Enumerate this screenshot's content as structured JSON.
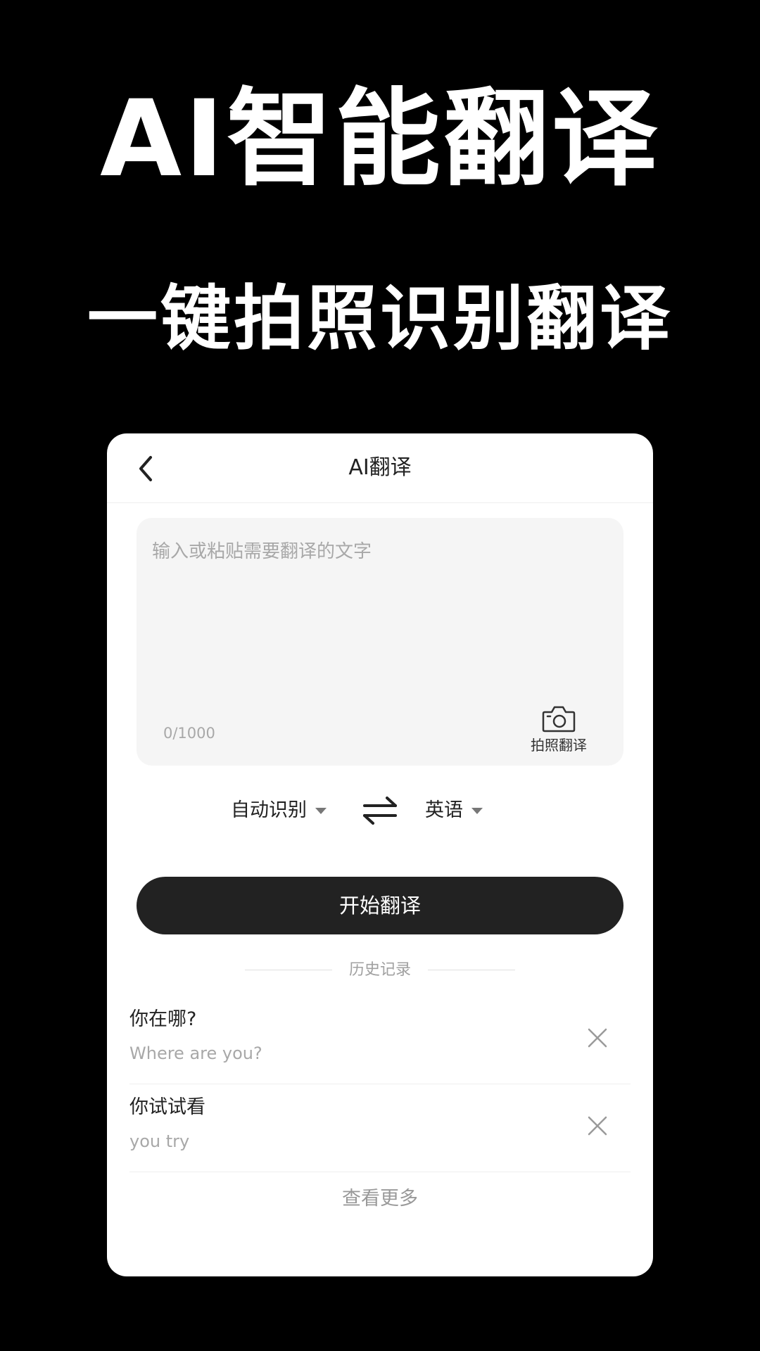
{
  "promo": {
    "headline": "AI智能翻译",
    "subheadline": "一键拍照识别翻译"
  },
  "nav": {
    "back_icon": "chevron-left-icon",
    "title": "AI翻译"
  },
  "input": {
    "placeholder": "输入或粘贴需要翻译的文字",
    "value": "",
    "char_count": "0/1000",
    "photo_translate_icon": "camera-icon",
    "photo_translate_label": "拍照翻译"
  },
  "languages": {
    "source": "自动识别",
    "target": "英语",
    "swap_icon": "swap-arrows-icon"
  },
  "actions": {
    "start_label": "开始翻译"
  },
  "history": {
    "title": "历史记录",
    "items": [
      {
        "source": "你在哪?",
        "target": "Where are you?"
      },
      {
        "source": "你试试看",
        "target": "you try"
      }
    ],
    "delete_icon": "close-icon",
    "view_more": "查看更多"
  },
  "colors": {
    "background": "#000000",
    "card": "#ffffff",
    "input_bg": "#f5f5f5",
    "button": "#222222",
    "muted_text": "#a8a8a8"
  }
}
